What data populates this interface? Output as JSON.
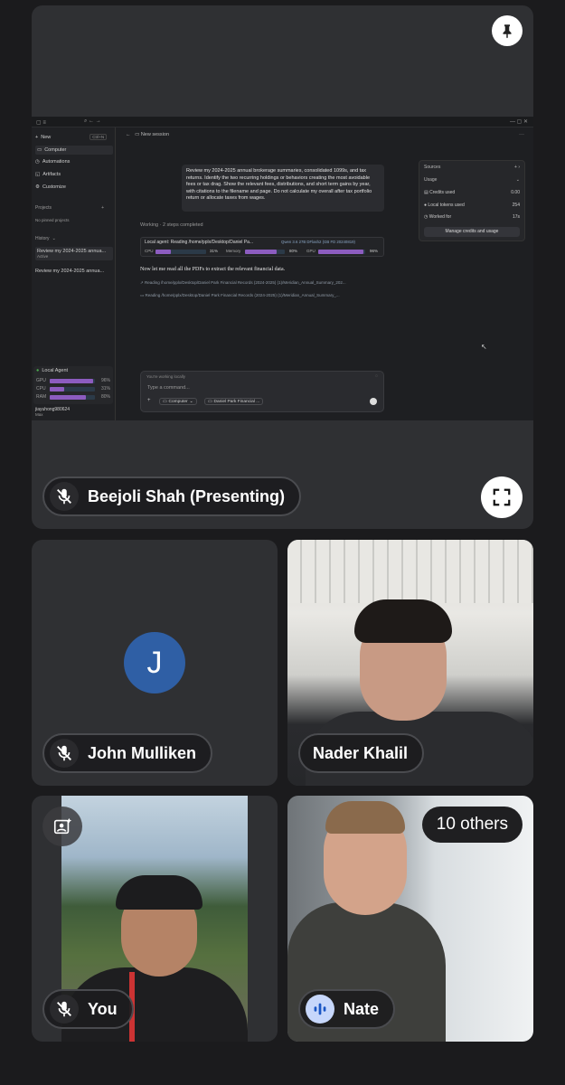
{
  "main": {
    "presenter_name": "Beejoli Shah (Presenting)",
    "screen": {
      "sidebar": {
        "new_label": "New",
        "new_shortcut": "Ctrl+N",
        "items": [
          "Computer",
          "Automations",
          "Artifacts",
          "Customize"
        ],
        "projects_label": "Projects",
        "no_projects": "No pinned projects",
        "history_label": "History",
        "history_items": [
          {
            "title": "Review my 2024-2025 annua...",
            "status": "Active"
          },
          {
            "title": "Review my 2024-2025 annua...",
            "status": ""
          }
        ],
        "local_agent_label": "Local Agent",
        "meters": [
          {
            "label": "GPU",
            "value": "96%",
            "level": 0.96
          },
          {
            "label": "CPU",
            "value": "31%",
            "level": 0.31
          },
          {
            "label": "RAM",
            "value": "80%",
            "level": 0.8
          }
        ],
        "user_name": "jiayuhong980624",
        "user_plan": "Max"
      },
      "header_title": "New session",
      "prompt": "Review my 2024-2025 annual brokerage summaries, consolidated 1099s, and tax returns. Identify the two recurring holdings or behaviors creating the most avoidable fees or tax drag. Show the relevant fees, distributions, and short term gains by year, with citations to the filename and page. Do not calculate my overall after tax portfolio return or allocate taxes from wages.",
      "working_label": "Working · 2 steps completed",
      "agent_status": "Local agent: Reading /home/pplx/Desktop/Daniel Pa...",
      "model_label": "Qwen 3.6 27B DFlash2 (GB FD 20240819)",
      "agent_meters": [
        {
          "label": "CPU",
          "value": "31%",
          "level": 0.31
        },
        {
          "label": "Memory",
          "value": "80%",
          "level": 0.8
        },
        {
          "label": "GPU",
          "value": "96%",
          "level": 0.96
        }
      ],
      "message": "Now let me read all the PDFs to extract the relevant financial data.",
      "steps": [
        "Reading /home/pplx/Desktop/Daniel Park Financial Records (2024-2025) (1)/Meridian_Annual_Summary_202...",
        "Reading /home/pplx/Desktop/Daniel Park Financial Records (2024-2025) (1)/Meridian_Annual_Summary_..."
      ],
      "side_panel": {
        "sources_label": "Sources",
        "usage_label": "Usage",
        "rows": [
          {
            "label": "Credits used",
            "value": "0.00"
          },
          {
            "label": "Local tokens used",
            "value": "254"
          },
          {
            "label": "Worked for",
            "value": "17s"
          }
        ],
        "manage_button": "Manage credits and usage"
      },
      "composer": {
        "local_note": "You're working locally",
        "placeholder": "Type a command...",
        "computer_chip": "Computer",
        "folder_chip": "Daniel Park Financial ..."
      }
    }
  },
  "participants": [
    {
      "name": "John Mulliken",
      "initial": "J",
      "avatar_color": "#2f5fa5",
      "muted": true
    },
    {
      "name": "Nader Khalil",
      "muted": false
    },
    {
      "name": "You",
      "muted": true
    },
    {
      "name": "Nate",
      "speaking": true
    }
  ],
  "others_label": "10 others"
}
